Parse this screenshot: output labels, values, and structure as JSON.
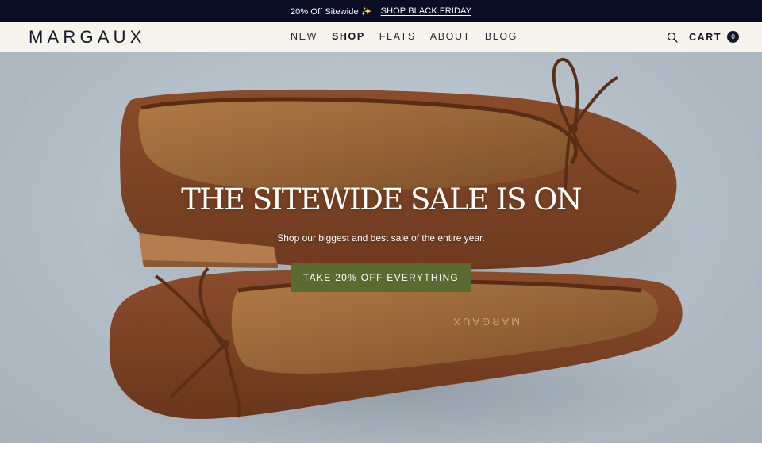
{
  "announcement": {
    "promo_text": "20% Off Sitewide ✨",
    "link_text": "SHOP BLACK FRIDAY"
  },
  "header": {
    "logo": "MARGAUX",
    "nav": [
      {
        "label": "NEW",
        "active": false
      },
      {
        "label": "SHOP",
        "active": true
      },
      {
        "label": "FLATS",
        "active": false
      },
      {
        "label": "ABOUT",
        "active": false
      },
      {
        "label": "BLOG",
        "active": false
      }
    ],
    "search_icon": "search-icon",
    "cart_label": "CART",
    "cart_count": "0"
  },
  "hero": {
    "title": "THE SITEWIDE SALE IS ON",
    "subtitle": "Shop our biggest and best sale of the entire year.",
    "cta_label": "TAKE 20% OFF EVERYTHING",
    "shoe_brand_stamp": "MARGAUX"
  },
  "colors": {
    "announcement_bg": "#0a0d24",
    "header_bg": "#f7f4ee",
    "cta_bg": "#5a6a30",
    "hero_bg": "#b8c2cb",
    "leather": "#7a4325"
  }
}
